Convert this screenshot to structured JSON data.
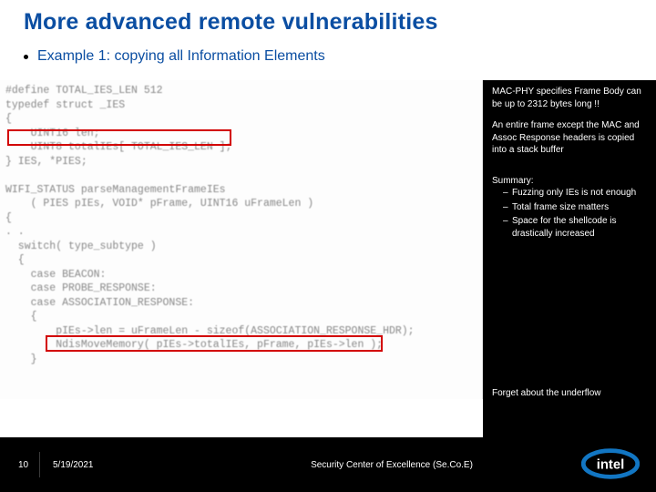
{
  "title": "More advanced remote vulnerabilities",
  "example": "Example 1: copying all Information Elements",
  "code": "#define TOTAL_IES_LEN 512\ntypedef struct _IES\n{\n    UINT16 len;\n    UINT8 totalIEs[ TOTAL_IES_LEN ];\n} IES, *PIES;\n\nWIFI_STATUS parseManagementFrameIEs\n    ( PIES pIEs, VOID* pFrame, UINT16 uFrameLen )\n{\n. .\n  switch( type_subtype )\n  {\n    case BEACON:\n    case PROBE_RESPONSE:\n    case ASSOCIATION_RESPONSE:\n    {\n        pIEs->len = uFrameLen - sizeof(ASSOCIATION_RESPONSE_HDR);\n        NdisMoveMemory( pIEs->totalIEs, pFrame, pIEs->len );\n    }\n",
  "callouts": {
    "c1": "MAC-PHY specifies Frame Body can be up to 2312 bytes long !!",
    "c2": "An entire frame except the MAC and Assoc Response headers is copied into a stack buffer"
  },
  "summary": {
    "head": "Summary:",
    "items": [
      "Fuzzing only IEs is not enough",
      "Total frame size matters",
      "Space for the shellcode is drastically increased"
    ]
  },
  "forget": "Forget about the underflow",
  "footer": {
    "num": "10",
    "date": "5/19/2021",
    "org": "Security Center of Excellence (Se.Co.E)"
  }
}
